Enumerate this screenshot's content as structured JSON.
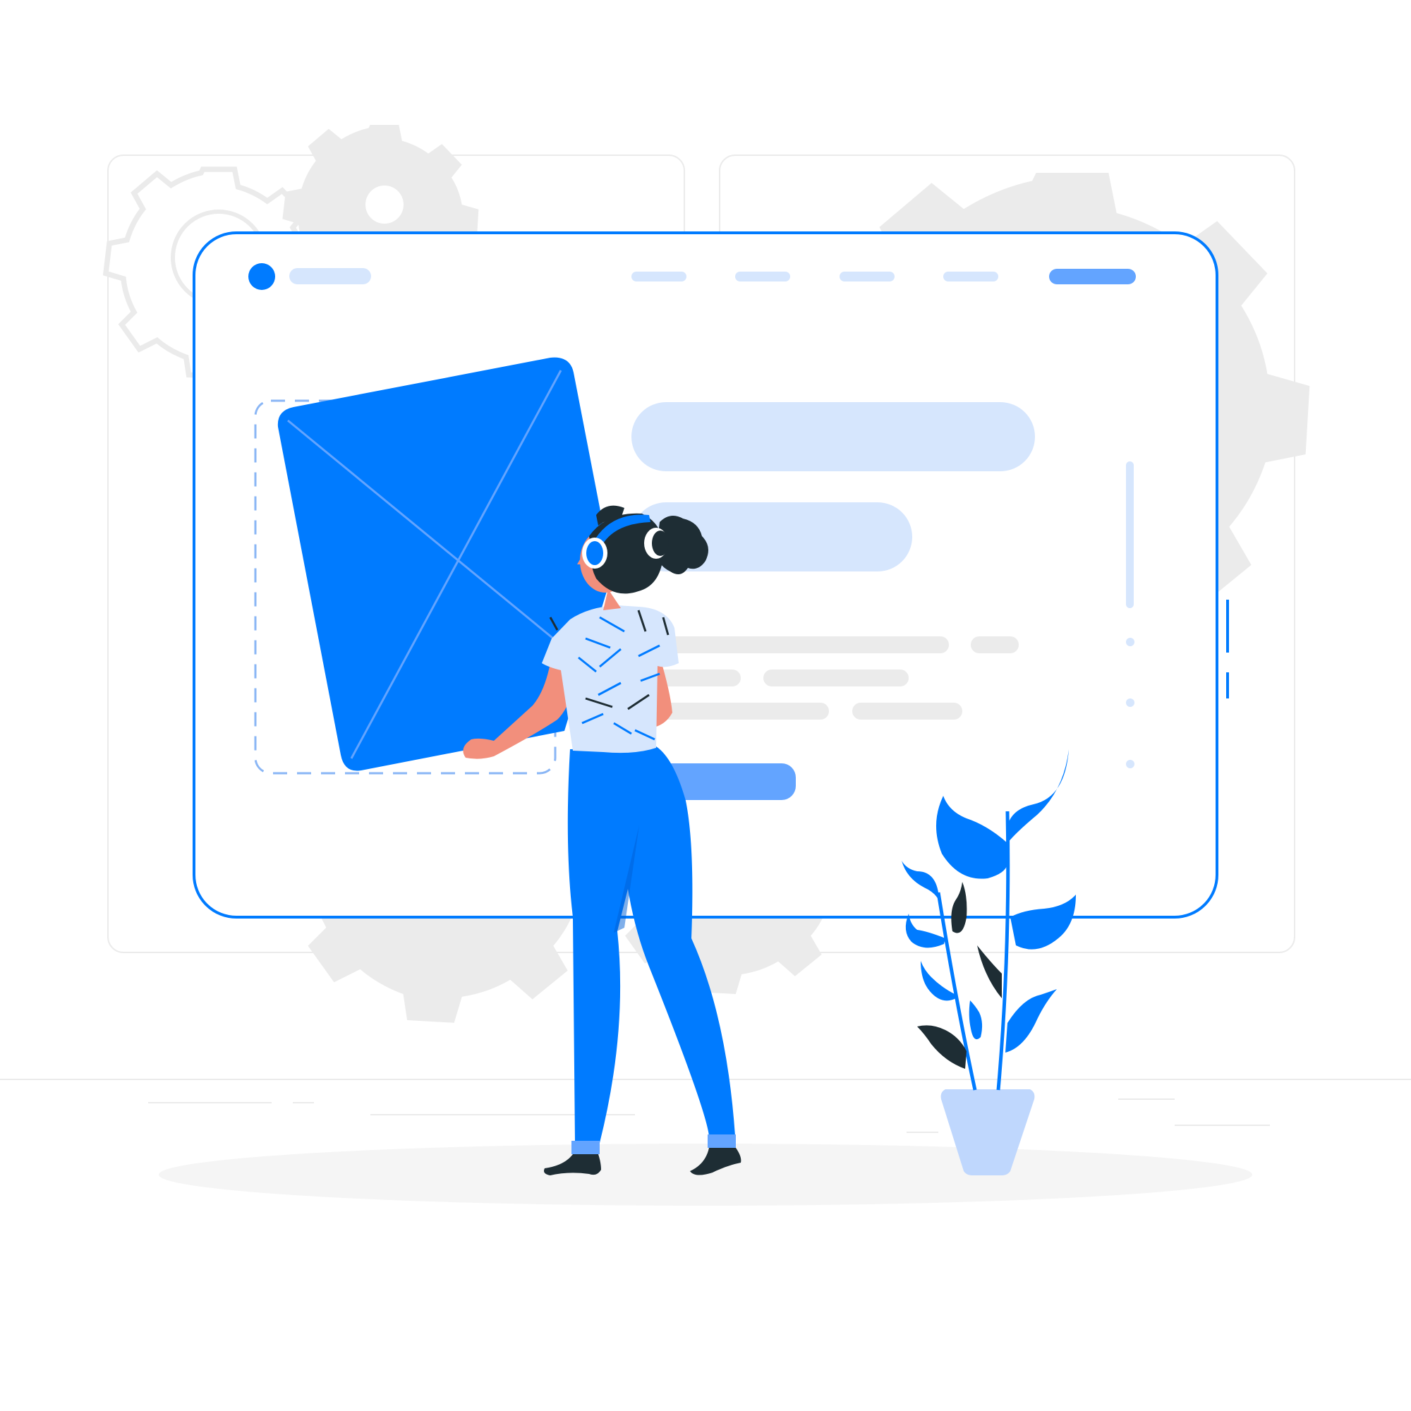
{
  "illustration": {
    "kind": "web-design-mockup",
    "colors": {
      "primary": "#007BFF",
      "primary_light": "#63A4FF",
      "pale_blue": "#D6E6FD",
      "plant_pot": "#BFD7FD",
      "dark": "#1E2D34",
      "skin": "#F28F7C",
      "gear_gray": "#EBEBEB",
      "line_gray": "#E6E6E6",
      "floor_shadow": "#F5F5F5",
      "white": "#FFFFFF"
    },
    "icons": {
      "logo_dot": "circle-dot",
      "gears": "gear",
      "envelope": "mail-envelope",
      "plant": "potted-plant",
      "person": "woman-with-headphones"
    },
    "browser": {
      "nav_link_count": 4,
      "has_cta_pill": true,
      "scrollbar": true
    }
  }
}
